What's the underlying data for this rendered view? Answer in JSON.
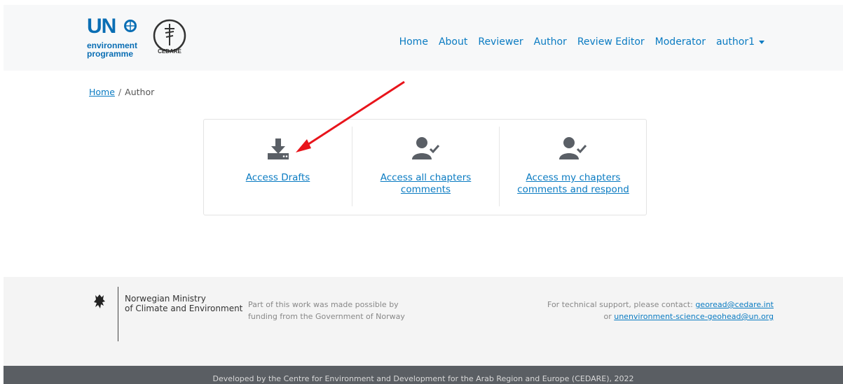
{
  "header": {
    "logo_un": "UN",
    "logo_line1": "environment",
    "logo_line2": "programme",
    "logo_cedare": "CEDARE",
    "nav": [
      "Home",
      "About",
      "Reviewer",
      "Author",
      "Review Editor",
      "Moderator",
      "author1"
    ]
  },
  "breadcrumb": {
    "home": "Home",
    "separator": "/",
    "current": "Author"
  },
  "actions": [
    {
      "label": "Access Drafts",
      "icon": "download-icon"
    },
    {
      "label_line1": "Access all chapters",
      "label_line2": "comments",
      "icon": "user-check-icon"
    },
    {
      "label_line1": "Access my chapters",
      "label_line2": "comments and respond",
      "icon": "user-check-icon"
    }
  ],
  "footer": {
    "ministry_line1": "Norwegian Ministry",
    "ministry_line2": "of Climate and Environment",
    "funding_line1": "Part of this work was made possible by",
    "funding_line2": "funding from the Government of Norway",
    "support_text": "For technical support, please contact: ",
    "support_email1": "georead@cedare.int",
    "support_or": "or ",
    "support_email2": "unenvironment-science-geohead@un.org",
    "bottom_text": "Developed by the Centre for Environment and Development for the Arab Region and Europe (CEDARE), 2022"
  },
  "colors": {
    "link": "#0a7bc2",
    "icon": "#5a5f66",
    "arrow": "#e8141b",
    "footer_bar": "#5a5e63"
  }
}
